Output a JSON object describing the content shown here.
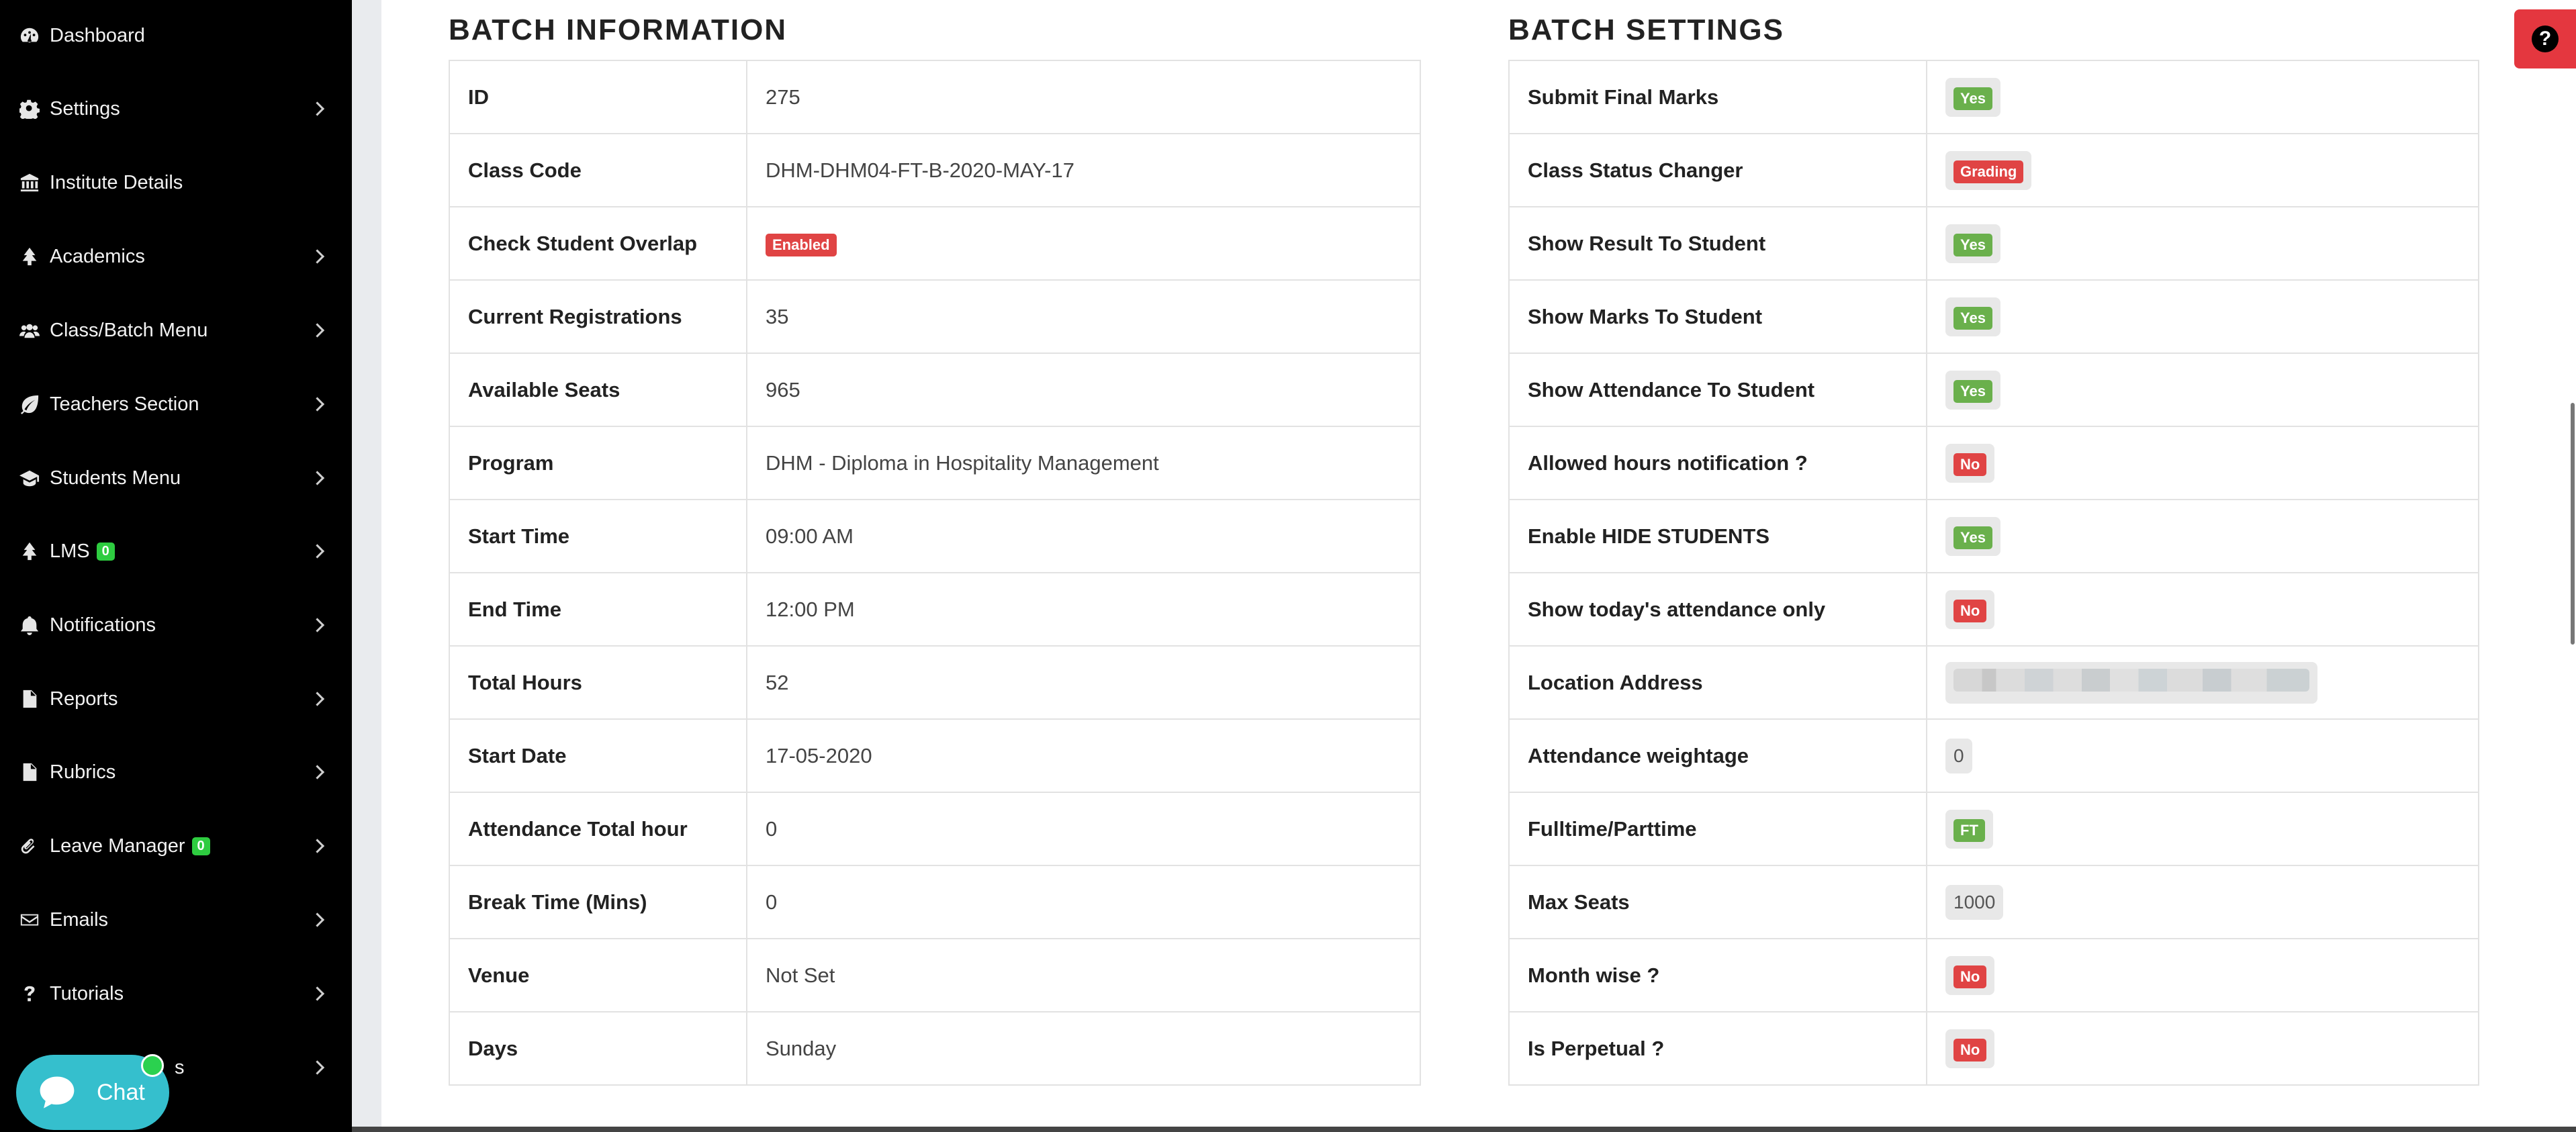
{
  "sidebar": {
    "items": [
      {
        "label": "Dashboard",
        "icon": "dashboard-icon",
        "chevron": false
      },
      {
        "label": "Settings",
        "icon": "gear-icon",
        "chevron": true
      },
      {
        "label": "Institute Details",
        "icon": "institution-icon",
        "chevron": false
      },
      {
        "label": "Academics",
        "icon": "tree-icon",
        "chevron": true
      },
      {
        "label": "Class/Batch Menu",
        "icon": "users-icon",
        "chevron": true
      },
      {
        "label": "Teachers Section",
        "icon": "leaf-icon",
        "chevron": true
      },
      {
        "label": "Students Menu",
        "icon": "graduation-cap-icon",
        "chevron": true
      },
      {
        "label": "LMS",
        "icon": "tree-icon",
        "chevron": true,
        "badge": "0"
      },
      {
        "label": "Notifications",
        "icon": "bell-icon",
        "chevron": true
      },
      {
        "label": "Reports",
        "icon": "file-icon",
        "chevron": true
      },
      {
        "label": "Rubrics",
        "icon": "file-icon",
        "chevron": true
      },
      {
        "label": "Leave Manager",
        "icon": "paperclip-icon",
        "chevron": true,
        "badge": "0"
      },
      {
        "label": "Emails",
        "icon": "envelope-icon",
        "chevron": true
      },
      {
        "label": "Tutorials",
        "icon": "question-icon",
        "chevron": true
      },
      {
        "label": "s",
        "icon": "",
        "chevron": true
      }
    ]
  },
  "chat": {
    "label": "Chat"
  },
  "batch_information": {
    "title": "BATCH INFORMATION",
    "rows": [
      {
        "label": "ID",
        "value": "275"
      },
      {
        "label": "Class Code",
        "value": "DHM-DHM04-FT-B-2020-MAY-17"
      },
      {
        "label": "Check Student Overlap",
        "badge": "Enabled",
        "color": "red"
      },
      {
        "label": "Current Registrations",
        "value": "35"
      },
      {
        "label": "Available Seats",
        "value": "965"
      },
      {
        "label": "Program",
        "value": "DHM - Diploma in Hospitality Management"
      },
      {
        "label": "Start Time",
        "value": "09:00 AM"
      },
      {
        "label": "End Time",
        "value": "12:00 PM"
      },
      {
        "label": "Total Hours",
        "value": "52"
      },
      {
        "label": "Start Date",
        "value": "17-05-2020"
      },
      {
        "label": "Attendance Total hour",
        "value": "0"
      },
      {
        "label": "Break Time (Mins)",
        "value": "0"
      },
      {
        "label": "Venue",
        "value": "Not Set"
      },
      {
        "label": "Days",
        "value": "Sunday"
      }
    ]
  },
  "batch_settings": {
    "title": "BATCH SETTINGS",
    "rows": [
      {
        "label": "Submit Final Marks",
        "badge": "Yes",
        "color": "green"
      },
      {
        "label": "Class Status Changer",
        "badge": "Grading",
        "color": "red"
      },
      {
        "label": "Show Result To Student",
        "badge": "Yes",
        "color": "green"
      },
      {
        "label": "Show Marks To Student",
        "badge": "Yes",
        "color": "green"
      },
      {
        "label": "Show Attendance To Student",
        "badge": "Yes",
        "color": "green"
      },
      {
        "label": "Allowed hours notification ?",
        "badge": "No",
        "color": "red"
      },
      {
        "label": "Enable HIDE STUDENTS",
        "badge": "Yes",
        "color": "green"
      },
      {
        "label": "Show today's attendance only",
        "badge": "No",
        "color": "red"
      },
      {
        "label": "Location Address",
        "blurred": true
      },
      {
        "label": "Attendance weightage",
        "pill_value": "0"
      },
      {
        "label": "Fulltime/Parttime",
        "badge": "FT",
        "color": "green"
      },
      {
        "label": "Max Seats",
        "pill_value": "1000"
      },
      {
        "label": "Month wise ?",
        "badge": "No",
        "color": "red"
      },
      {
        "label": "Is Perpetual ?",
        "badge": "No",
        "color": "red"
      }
    ]
  },
  "colors": {
    "green": "#6ab04c",
    "red": "#e04444",
    "sidebar": "#000000",
    "chat": "#35bfcd",
    "help": "#e4373f"
  }
}
